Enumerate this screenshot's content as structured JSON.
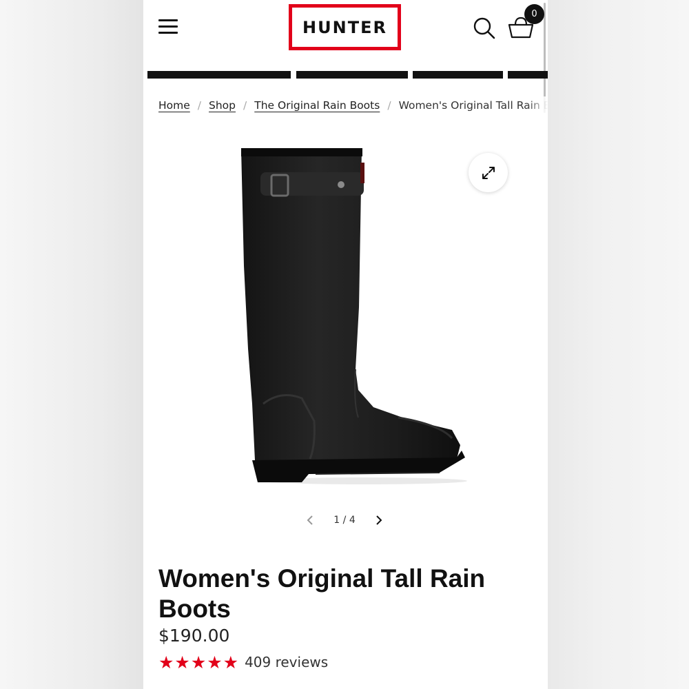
{
  "header": {
    "logo_text": "HUNTER",
    "cart_count": "0"
  },
  "breadcrumb": {
    "items": [
      "Home",
      "Shop",
      "The Original Rain Boots"
    ],
    "current": "Women's Original Tall Rain Boots"
  },
  "gallery": {
    "current": "1",
    "separator": "/",
    "total": "4"
  },
  "product": {
    "title": "Women's Original Tall Rain Boots",
    "price": "$190.00",
    "rating_stars": "★★★★★",
    "rating": 5,
    "reviews": "409 reviews"
  },
  "colors": {
    "brand_red": "#e2001a",
    "ink": "#111111"
  },
  "icons": [
    "menu-icon",
    "search-icon",
    "basket-icon",
    "expand-icon",
    "chevron-left-icon",
    "chevron-right-icon",
    "star-icon"
  ]
}
